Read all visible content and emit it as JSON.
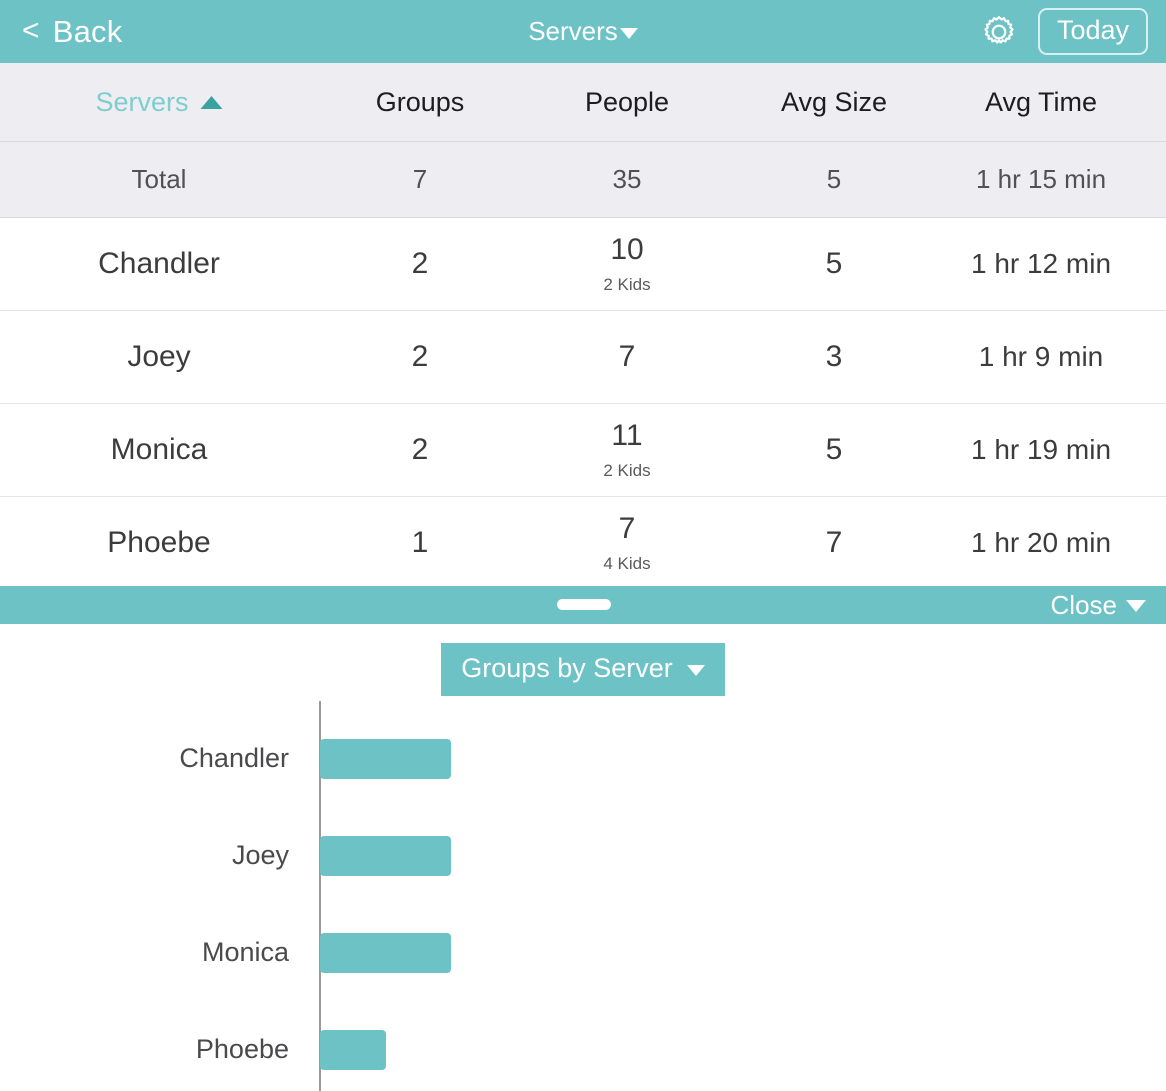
{
  "navbar": {
    "back_chevron": "<",
    "back_label": "Back",
    "title": "Servers",
    "gear_icon": "gear-icon",
    "today_label": "Today",
    "accent_color": "#6cc2c4"
  },
  "table": {
    "columns": [
      {
        "key": "server",
        "label": "Servers",
        "sorted": true,
        "sort_dir": "asc"
      },
      {
        "key": "groups",
        "label": "Groups"
      },
      {
        "key": "people",
        "label": "People"
      },
      {
        "key": "avg_size",
        "label": "Avg Size"
      },
      {
        "key": "avg_time",
        "label": "Avg Time"
      }
    ],
    "total_row": {
      "server": "Total",
      "groups": "7",
      "people": "35",
      "people_sub": "",
      "avg_size": "5",
      "avg_time": "1 hr 15 min"
    },
    "rows": [
      {
        "server": "Chandler",
        "groups": "2",
        "people": "10",
        "people_sub": "2 Kids",
        "avg_size": "5",
        "avg_time": "1 hr 12 min"
      },
      {
        "server": "Joey",
        "groups": "2",
        "people": "7",
        "people_sub": "",
        "avg_size": "3",
        "avg_time": "1 hr 9 min"
      },
      {
        "server": "Monica",
        "groups": "2",
        "people": "11",
        "people_sub": "2 Kids",
        "avg_size": "5",
        "avg_time": "1 hr 19 min"
      },
      {
        "server": "Phoebe",
        "groups": "1",
        "people": "7",
        "people_sub": "4 Kids",
        "avg_size": "7",
        "avg_time": "1 hr 20 min"
      }
    ]
  },
  "splitbar": {
    "drag_handle": "drag-handle",
    "close_label": "Close"
  },
  "chart_panel": {
    "selector_label": "Groups by Server"
  },
  "chart_data": {
    "type": "bar",
    "orientation": "horizontal",
    "title": "Groups by Server",
    "xlabel": "",
    "ylabel": "",
    "categories": [
      "Chandler",
      "Joey",
      "Monica",
      "Phoebe"
    ],
    "values": [
      2,
      2,
      2,
      1
    ],
    "xlim": [
      0,
      4
    ],
    "grid": false,
    "legend": false,
    "bar_color": "#6cc2c4",
    "axis_color": "#9a9a9a"
  }
}
